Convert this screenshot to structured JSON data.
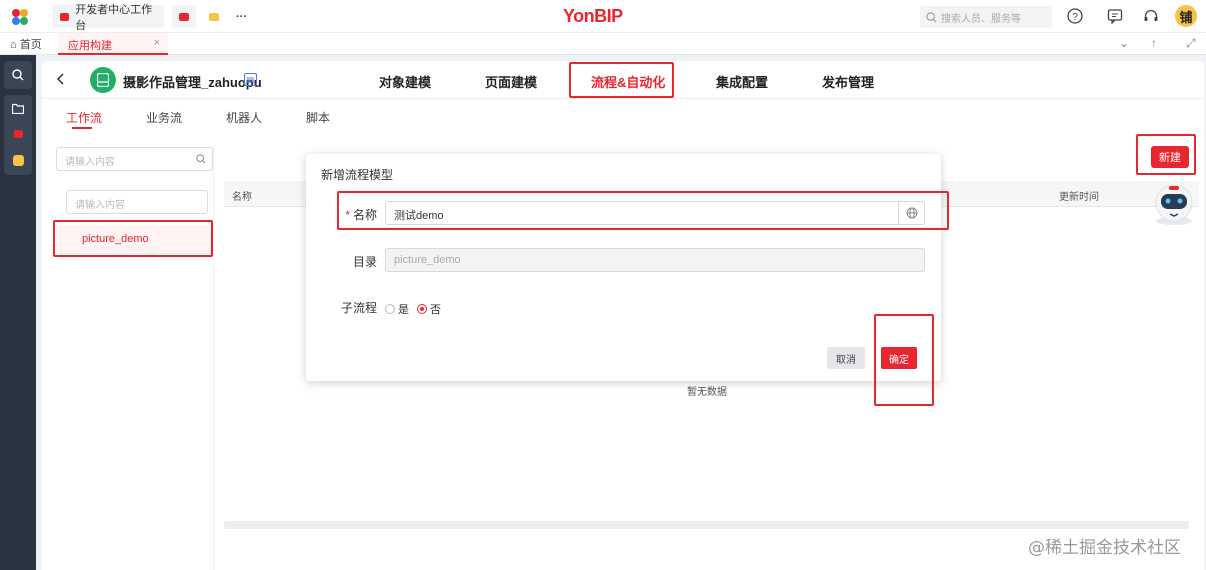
{
  "topbar": {
    "tab_label": "开发者中心工作台",
    "more": "···",
    "brand": "YonBIP",
    "search_placeholder": "搜索人员、服务等",
    "avatar_text": "铺"
  },
  "tabbar": {
    "home_label": "首页",
    "app_tab_label": "应用构建",
    "close_glyph": "×"
  },
  "app": {
    "name": "摄影作品管理_zahuopu",
    "nav": [
      "对象建模",
      "页面建模",
      "流程&自动化",
      "集成配置",
      "发布管理"
    ],
    "active_nav": "流程&自动化"
  },
  "subtabs": [
    "工作流",
    "业务流",
    "机器人",
    "脚本"
  ],
  "tree": {
    "search_placeholder": "请输入内容",
    "filter_placeholder": "请输入内容",
    "items": [
      "picture_demo"
    ]
  },
  "table": {
    "columns": [
      "名称",
      "更新时间"
    ],
    "empty_text": "暂无数据"
  },
  "new_button": "新建",
  "dialog": {
    "title": "新增流程模型",
    "name_label": "名称",
    "name_value": "测试demo",
    "dir_label": "目录",
    "dir_value": "picture_demo",
    "subflow_label": "子流程",
    "subflow_options": [
      "是",
      "否"
    ],
    "subflow_selected": "否",
    "cancel": "取消",
    "ok": "确定"
  },
  "watermark": "@稀土掘金技术社区",
  "colors": {
    "accent": "#e8262d",
    "rail": "#2a3340",
    "app_logo": "#22b069"
  }
}
